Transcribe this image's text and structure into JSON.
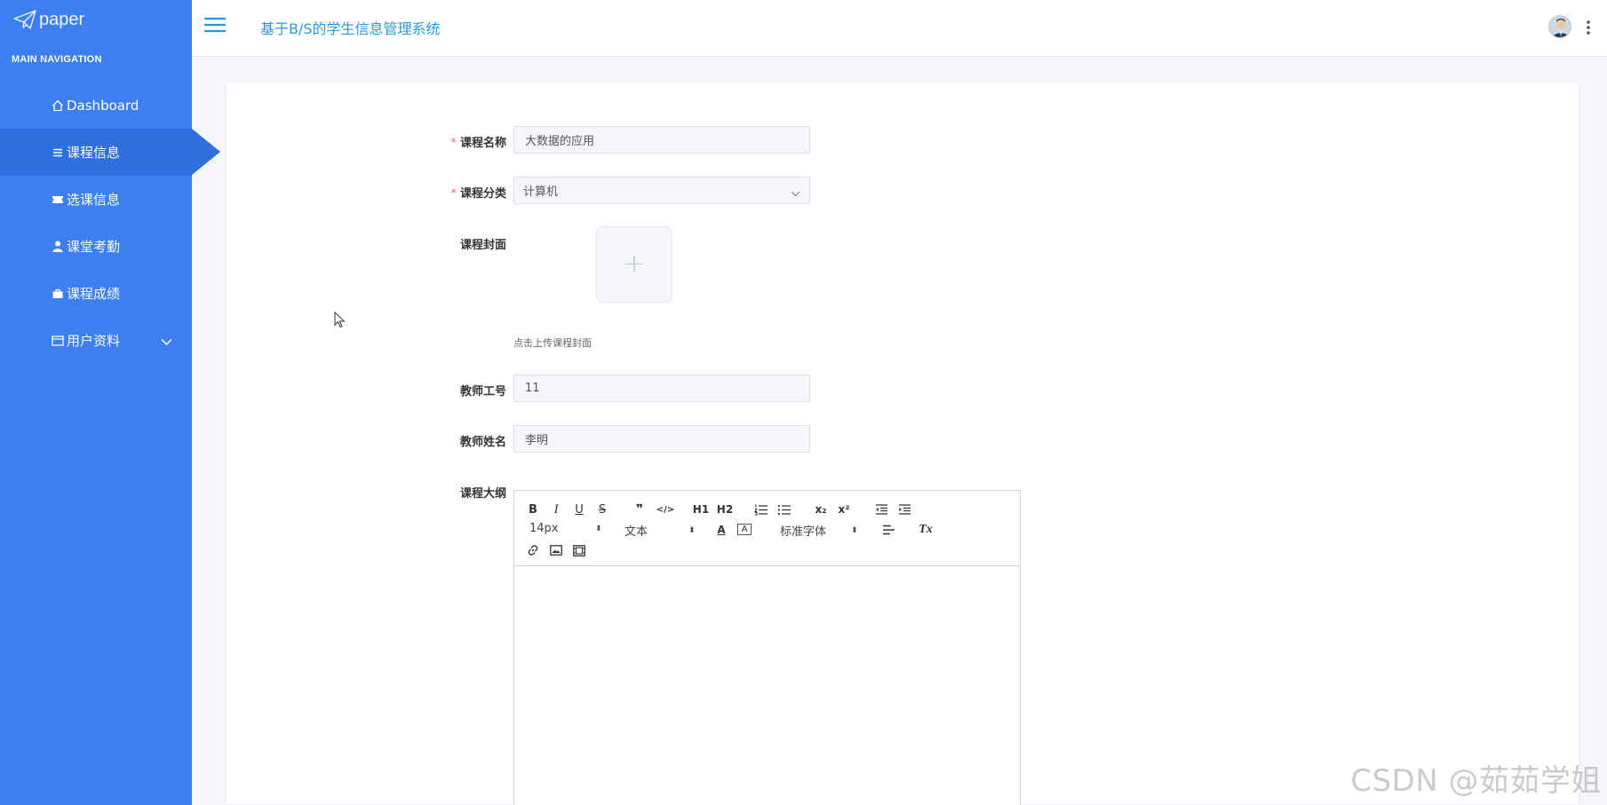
{
  "sidebar": {
    "logo": "paper",
    "nav_header": "MAIN NAVIGATION",
    "items": [
      {
        "label": "Dashboard",
        "icon": "home-icon"
      },
      {
        "label": "课程信息",
        "icon": "list-icon",
        "active": true
      },
      {
        "label": "选课信息",
        "icon": "ticket-icon"
      },
      {
        "label": "课堂考勤",
        "icon": "user-icon"
      },
      {
        "label": "课程成绩",
        "icon": "briefcase-icon"
      },
      {
        "label": "用户资料",
        "icon": "id-card-icon",
        "has_submenu": true
      }
    ],
    "color": "#3d7ef0",
    "active_color": "#2f6fde"
  },
  "header": {
    "title": "基于B/S的学生信息管理系统"
  },
  "form": {
    "course_name": {
      "label": "课程名称",
      "required": true,
      "value": "大数据的应用"
    },
    "course_category": {
      "label": "课程分类",
      "required": true,
      "value": "计算机"
    },
    "course_cover": {
      "label": "课程封面",
      "hint": "点击上传课程封面",
      "plus": "+"
    },
    "teacher_id": {
      "label": "教师工号",
      "value": "11"
    },
    "teacher_name": {
      "label": "教师姓名",
      "value": "李明"
    },
    "course_outline": {
      "label": "课程大纲"
    },
    "required_mark": "*"
  },
  "editor": {
    "bold": "B",
    "italic": "I",
    "underline": "U",
    "strike": "S",
    "blockquote": "❞",
    "code": "</>",
    "h1": "H1",
    "h2": "H2",
    "font_size": "14px",
    "text_style": "文本",
    "font_color": "A",
    "bg_color": "A",
    "font_family": "标准字体",
    "subscript": "x₂",
    "superscript": "x²",
    "clear_format": "Tx"
  },
  "watermark": "CSDN @茹茹学姐"
}
